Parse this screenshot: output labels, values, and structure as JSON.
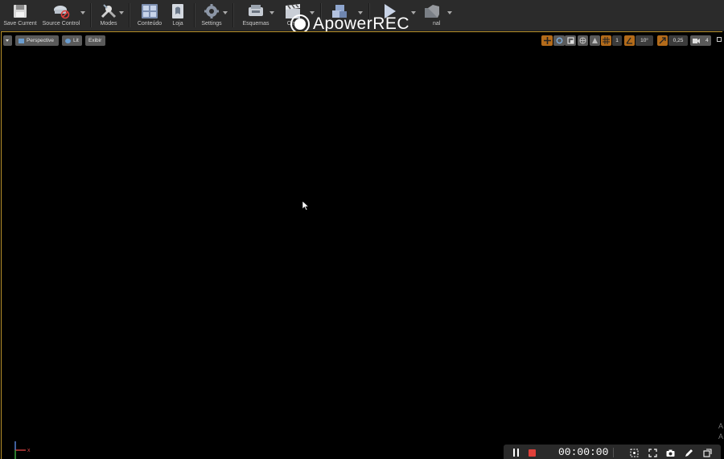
{
  "toolbar": {
    "items": [
      {
        "label": "Save Current",
        "icon": "save-icon"
      },
      {
        "label": "Source Control",
        "icon": "source-control-icon"
      },
      {
        "label": "Modes",
        "icon": "modes-icon"
      },
      {
        "label": "Conteúdo",
        "icon": "content-icon"
      },
      {
        "label": "Loja",
        "icon": "store-icon"
      },
      {
        "label": "Settings",
        "icon": "settings-icon"
      },
      {
        "label": "Esquemas",
        "icon": "blueprints-icon"
      },
      {
        "label": "Cine",
        "icon": "cinematics-icon"
      },
      {
        "label": "",
        "icon": "build-icon"
      },
      {
        "label": "",
        "icon": "play-icon"
      },
      {
        "label": "nal",
        "icon": "launch-icon"
      }
    ]
  },
  "watermark": {
    "text": "ApowerREC"
  },
  "viewport": {
    "perspective_label": "Perspective",
    "lit_label": "Lit",
    "show_label": "Exibir",
    "rotation_snap": "10°",
    "scale_snap": "0,25",
    "camera_speed": "4",
    "grid_snap": "1"
  },
  "recorder": {
    "time": "00:00:00"
  },
  "side_letters": [
    "A",
    "A"
  ],
  "colors": {
    "accent": "#b8912b",
    "toolbar_bg": "#2b2b2b",
    "record_red": "#e0403a"
  }
}
